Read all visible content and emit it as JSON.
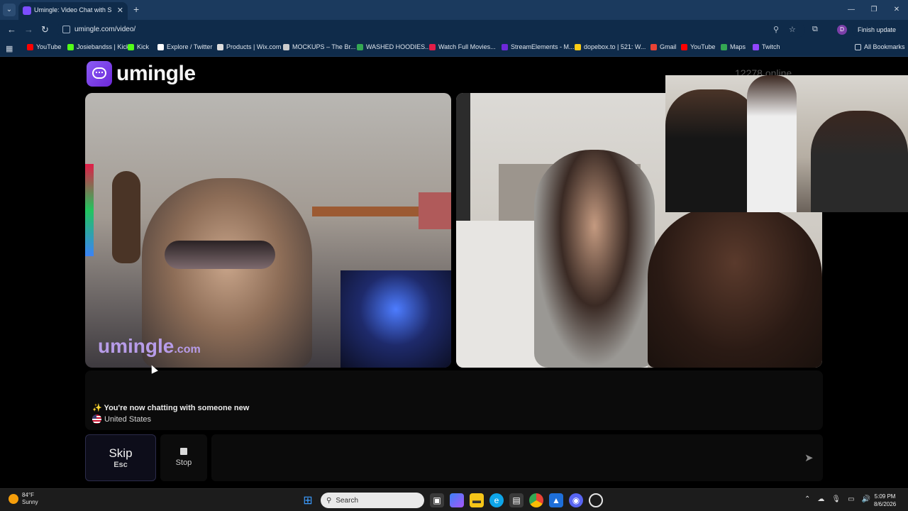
{
  "browser": {
    "tab_title": "Umingle: Video Chat with S",
    "url": "umingle.com/video/",
    "finish_update_label": "Finish update",
    "profile_initial": "D",
    "all_bookmarks_label": "All Bookmarks"
  },
  "bookmarks": [
    {
      "label": "YouTube",
      "icon": "youtube-icon",
      "color": "#ff0000"
    },
    {
      "label": "Josiebandss | Kick",
      "icon": "kick-icon",
      "color": "#53fc18"
    },
    {
      "label": "Kick",
      "icon": "kick-icon",
      "color": "#53fc18"
    },
    {
      "label": "Explore / Twitter",
      "icon": "x-icon",
      "color": "#ffffff"
    },
    {
      "label": "Products | Wix.com",
      "icon": "wix-icon",
      "color": "#dddddd"
    },
    {
      "label": "MOCKUPS – The Br...",
      "icon": "globe-icon",
      "color": "#cccccc"
    },
    {
      "label": "WASHED HOODIES...",
      "icon": "drive-icon",
      "color": "#34a853"
    },
    {
      "label": "Watch Full Movies...",
      "icon": "movie-icon",
      "color": "#e11d48"
    },
    {
      "label": "StreamElements - M...",
      "icon": "streamelements-icon",
      "color": "#6d28d9"
    },
    {
      "label": "dopebox.to | 521: W...",
      "icon": "dopebox-icon",
      "color": "#facc15"
    },
    {
      "label": "Gmail",
      "icon": "gmail-icon",
      "color": "#ea4335"
    },
    {
      "label": "YouTube",
      "icon": "youtube-icon",
      "color": "#ff0000"
    },
    {
      "label": "Maps",
      "icon": "maps-icon",
      "color": "#34a853"
    },
    {
      "label": "Twitch",
      "icon": "twitch-icon",
      "color": "#9146ff"
    }
  ],
  "site": {
    "logo_text": "umingle",
    "online_count": "12278",
    "online_suffix": "online",
    "watermark_main": "umingle",
    "watermark_suffix": ".com",
    "accent_color": "#8b5cf6"
  },
  "chat": {
    "status_message": "✨ You're now chatting with someone new",
    "location": "United States"
  },
  "controls": {
    "skip_label": "Skip",
    "skip_shortcut": "Esc",
    "stop_label": "Stop",
    "input_placeholder": ""
  },
  "taskbar": {
    "temperature": "84°F",
    "condition": "Sunny",
    "search_label": "Search",
    "time": "5:09 PM",
    "date": "8/6/2026"
  }
}
